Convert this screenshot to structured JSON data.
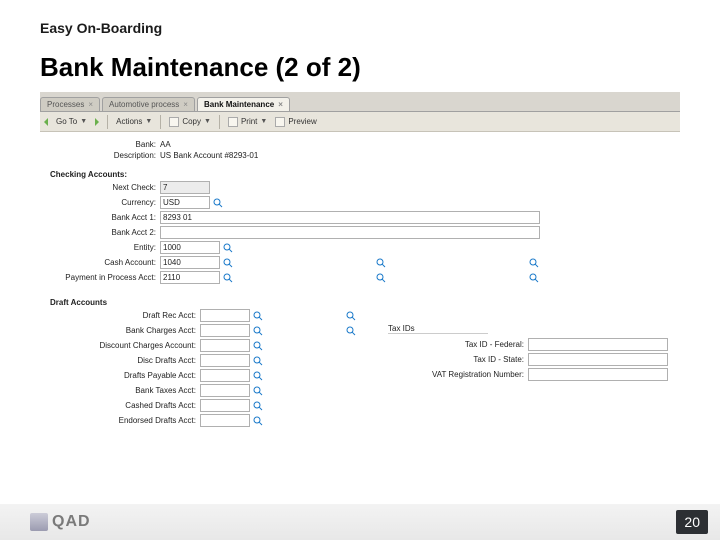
{
  "breadcrumb": "Easy On-Boarding",
  "title": "Bank Maintenance (2 of 2)",
  "tabs": [
    {
      "label": "Processes"
    },
    {
      "label": "Automotive process"
    },
    {
      "label": "Bank Maintenance"
    }
  ],
  "active_tab": 2,
  "toolbar": {
    "goto": "Go To",
    "actions": "Actions",
    "copy": "Copy",
    "print": "Print",
    "preview": "Preview"
  },
  "header": {
    "bank_label": "Bank:",
    "bank_value": "AA",
    "desc_label": "Description:",
    "desc_value": "US Bank Account #8293-01"
  },
  "sections": {
    "checking": "Checking Accounts:",
    "draft": "Draft Accounts",
    "tax": "Tax IDs"
  },
  "checking": {
    "next_check_label": "Next Check:",
    "next_check_value": "7",
    "currency_label": "Currency:",
    "currency_value": "USD",
    "bank_acct1_label": "Bank Acct 1:",
    "bank_acct1_value": "8293 01",
    "bank_acct2_label": "Bank Acct 2:",
    "bank_acct2_value": "",
    "entity_label": "Entity:",
    "entity_value": "1000",
    "cash_acct_label": "Cash Account:",
    "cash_acct_value": "1040",
    "pip_label": "Payment in Process Acct:",
    "pip_value": "2110"
  },
  "draft": {
    "draft_rec_label": "Draft Rec Acct:",
    "bank_charges_label": "Bank Charges Acct:",
    "discount_charges_label": "Discount Charges Account:",
    "disc_drafts_label": "Disc Drafts Acct:",
    "drafts_payable_label": "Drafts Payable Acct:",
    "bank_taxes_label": "Bank Taxes Acct:",
    "cashed_drafts_label": "Cashed Drafts Acct:",
    "endorsed_drafts_label": "Endorsed Drafts Acct:"
  },
  "tax": {
    "federal_label": "Tax ID - Federal:",
    "state_label": "Tax ID - State:",
    "vat_label": "VAT Registration Number:"
  },
  "page_number": "20",
  "logo_text": "QAD"
}
